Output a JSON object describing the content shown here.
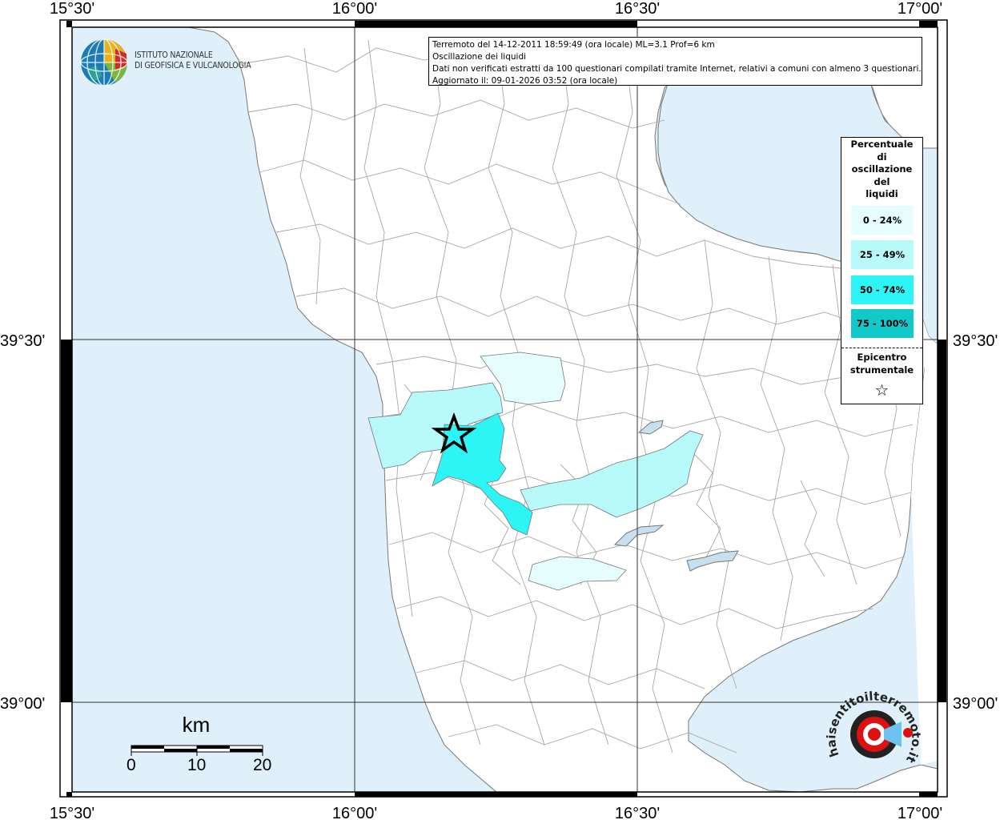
{
  "header": {
    "line1": "Terremoto del 14-12-2011 18:59:49 (ora locale) ML=3.1 Prof=6 km",
    "line2": "Oscillazione dei liquidi",
    "line3": "Dati non verificati estratti da 100 questionari compilati tramite Internet, relativi a comuni con almeno 3 questionari.",
    "line4": "Aggiornato il: 09-01-2026 03:52 (ora locale)"
  },
  "logo": {
    "line1": "ISTITUTO NAZIONALE",
    "line2": "DI GEOFISICA E VULCANOLOGIA"
  },
  "axes": {
    "lon_ticks": [
      "15°30'",
      "16°00'",
      "16°30'",
      "17°00'"
    ],
    "lat_ticks": [
      "39°30'",
      "39°00'"
    ]
  },
  "legend": {
    "title": [
      "Percentuale",
      "di",
      "oscillazione",
      "del",
      "liquidi"
    ],
    "classes": [
      {
        "label": "0 - 24%",
        "color": "#e6fdfd"
      },
      {
        "label": "25 - 49%",
        "color": "#b8fafa"
      },
      {
        "label": "50 - 74%",
        "color": "#2ef5f5"
      },
      {
        "label": "75 - 100%",
        "color": "#12c9c9"
      }
    ],
    "epicenter_line1": "Epicentro",
    "epicenter_line2": "strumentale",
    "epicenter_symbol": "☆"
  },
  "scalebar": {
    "unit": "km",
    "labels": [
      "0",
      "10",
      "20"
    ]
  },
  "watermark": {
    "text": "haisentitoilterremoto.it  www."
  },
  "colors": {
    "sea": "#dff0fb",
    "land": "#ffffff",
    "boundary": "#9a9a9a",
    "lake": "#c8dfee"
  }
}
